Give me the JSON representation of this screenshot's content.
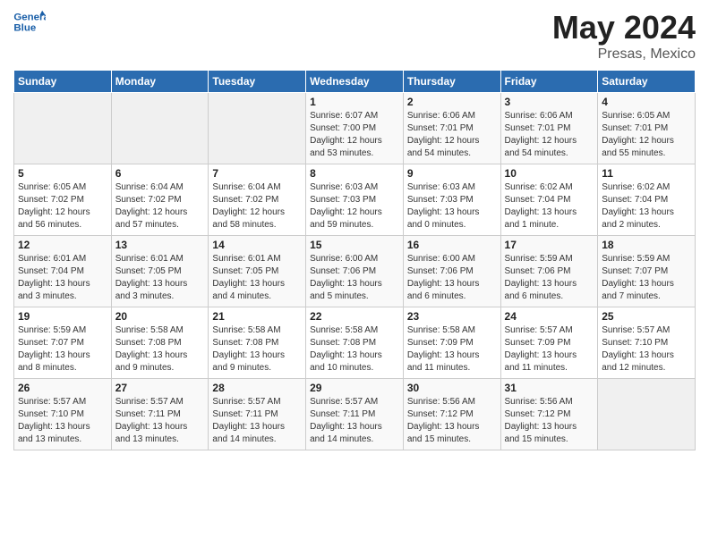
{
  "header": {
    "title": "May 2024",
    "subtitle": "Presas, Mexico"
  },
  "calendar": {
    "headers": [
      "Sunday",
      "Monday",
      "Tuesday",
      "Wednesday",
      "Thursday",
      "Friday",
      "Saturday"
    ],
    "weeks": [
      [
        {
          "day": "",
          "info": ""
        },
        {
          "day": "",
          "info": ""
        },
        {
          "day": "",
          "info": ""
        },
        {
          "day": "1",
          "info": "Sunrise: 6:07 AM\nSunset: 7:00 PM\nDaylight: 12 hours\nand 53 minutes."
        },
        {
          "day": "2",
          "info": "Sunrise: 6:06 AM\nSunset: 7:01 PM\nDaylight: 12 hours\nand 54 minutes."
        },
        {
          "day": "3",
          "info": "Sunrise: 6:06 AM\nSunset: 7:01 PM\nDaylight: 12 hours\nand 54 minutes."
        },
        {
          "day": "4",
          "info": "Sunrise: 6:05 AM\nSunset: 7:01 PM\nDaylight: 12 hours\nand 55 minutes."
        }
      ],
      [
        {
          "day": "5",
          "info": "Sunrise: 6:05 AM\nSunset: 7:02 PM\nDaylight: 12 hours\nand 56 minutes."
        },
        {
          "day": "6",
          "info": "Sunrise: 6:04 AM\nSunset: 7:02 PM\nDaylight: 12 hours\nand 57 minutes."
        },
        {
          "day": "7",
          "info": "Sunrise: 6:04 AM\nSunset: 7:02 PM\nDaylight: 12 hours\nand 58 minutes."
        },
        {
          "day": "8",
          "info": "Sunrise: 6:03 AM\nSunset: 7:03 PM\nDaylight: 12 hours\nand 59 minutes."
        },
        {
          "day": "9",
          "info": "Sunrise: 6:03 AM\nSunset: 7:03 PM\nDaylight: 13 hours\nand 0 minutes."
        },
        {
          "day": "10",
          "info": "Sunrise: 6:02 AM\nSunset: 7:04 PM\nDaylight: 13 hours\nand 1 minute."
        },
        {
          "day": "11",
          "info": "Sunrise: 6:02 AM\nSunset: 7:04 PM\nDaylight: 13 hours\nand 2 minutes."
        }
      ],
      [
        {
          "day": "12",
          "info": "Sunrise: 6:01 AM\nSunset: 7:04 PM\nDaylight: 13 hours\nand 3 minutes."
        },
        {
          "day": "13",
          "info": "Sunrise: 6:01 AM\nSunset: 7:05 PM\nDaylight: 13 hours\nand 3 minutes."
        },
        {
          "day": "14",
          "info": "Sunrise: 6:01 AM\nSunset: 7:05 PM\nDaylight: 13 hours\nand 4 minutes."
        },
        {
          "day": "15",
          "info": "Sunrise: 6:00 AM\nSunset: 7:06 PM\nDaylight: 13 hours\nand 5 minutes."
        },
        {
          "day": "16",
          "info": "Sunrise: 6:00 AM\nSunset: 7:06 PM\nDaylight: 13 hours\nand 6 minutes."
        },
        {
          "day": "17",
          "info": "Sunrise: 5:59 AM\nSunset: 7:06 PM\nDaylight: 13 hours\nand 6 minutes."
        },
        {
          "day": "18",
          "info": "Sunrise: 5:59 AM\nSunset: 7:07 PM\nDaylight: 13 hours\nand 7 minutes."
        }
      ],
      [
        {
          "day": "19",
          "info": "Sunrise: 5:59 AM\nSunset: 7:07 PM\nDaylight: 13 hours\nand 8 minutes."
        },
        {
          "day": "20",
          "info": "Sunrise: 5:58 AM\nSunset: 7:08 PM\nDaylight: 13 hours\nand 9 minutes."
        },
        {
          "day": "21",
          "info": "Sunrise: 5:58 AM\nSunset: 7:08 PM\nDaylight: 13 hours\nand 9 minutes."
        },
        {
          "day": "22",
          "info": "Sunrise: 5:58 AM\nSunset: 7:08 PM\nDaylight: 13 hours\nand 10 minutes."
        },
        {
          "day": "23",
          "info": "Sunrise: 5:58 AM\nSunset: 7:09 PM\nDaylight: 13 hours\nand 11 minutes."
        },
        {
          "day": "24",
          "info": "Sunrise: 5:57 AM\nSunset: 7:09 PM\nDaylight: 13 hours\nand 11 minutes."
        },
        {
          "day": "25",
          "info": "Sunrise: 5:57 AM\nSunset: 7:10 PM\nDaylight: 13 hours\nand 12 minutes."
        }
      ],
      [
        {
          "day": "26",
          "info": "Sunrise: 5:57 AM\nSunset: 7:10 PM\nDaylight: 13 hours\nand 13 minutes."
        },
        {
          "day": "27",
          "info": "Sunrise: 5:57 AM\nSunset: 7:11 PM\nDaylight: 13 hours\nand 13 minutes."
        },
        {
          "day": "28",
          "info": "Sunrise: 5:57 AM\nSunset: 7:11 PM\nDaylight: 13 hours\nand 14 minutes."
        },
        {
          "day": "29",
          "info": "Sunrise: 5:57 AM\nSunset: 7:11 PM\nDaylight: 13 hours\nand 14 minutes."
        },
        {
          "day": "30",
          "info": "Sunrise: 5:56 AM\nSunset: 7:12 PM\nDaylight: 13 hours\nand 15 minutes."
        },
        {
          "day": "31",
          "info": "Sunrise: 5:56 AM\nSunset: 7:12 PM\nDaylight: 13 hours\nand 15 minutes."
        },
        {
          "day": "",
          "info": ""
        }
      ]
    ]
  }
}
